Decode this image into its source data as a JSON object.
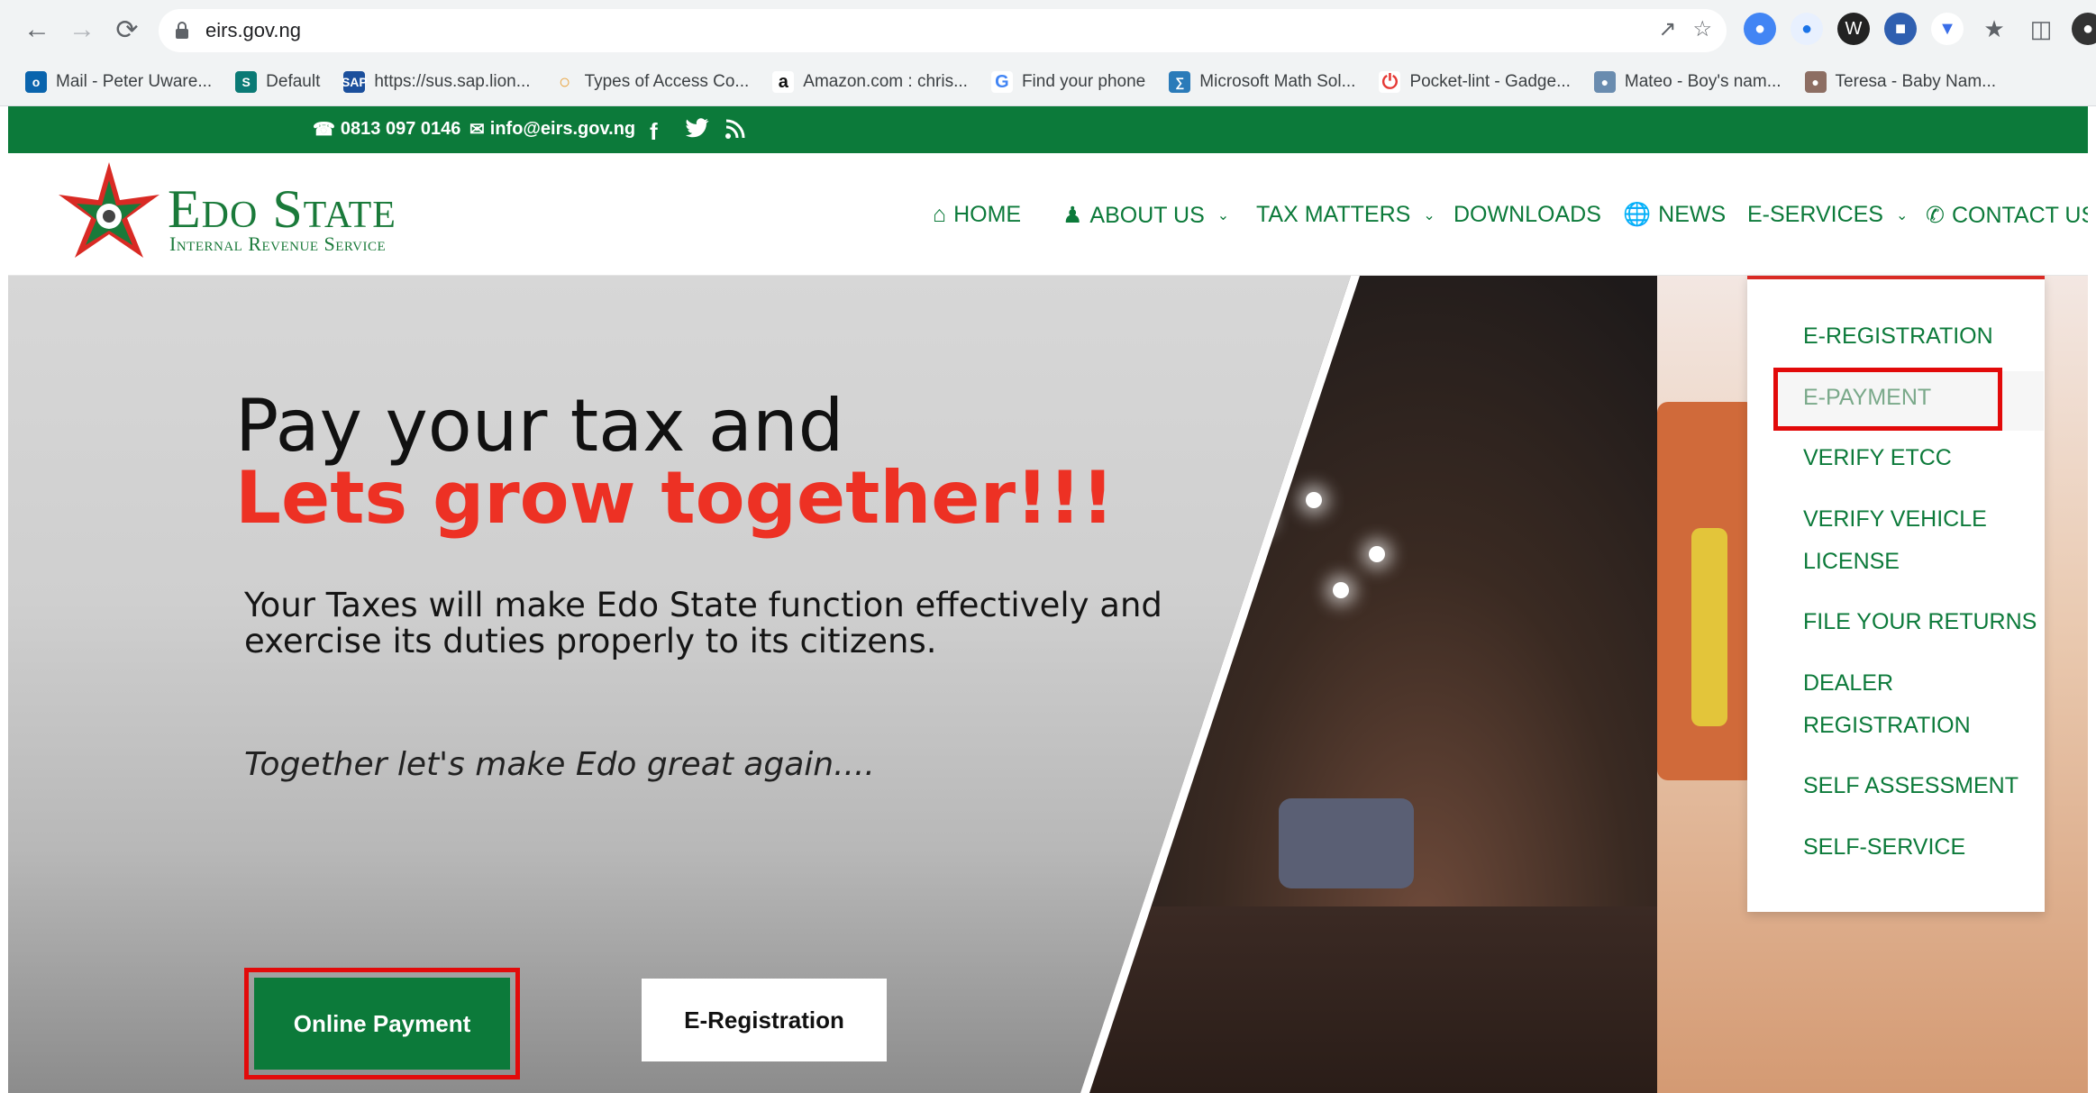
{
  "browser": {
    "url": "eirs.gov.ng",
    "bookmarks": [
      {
        "label": "Mail - Peter Uware...",
        "icon": "outlook-icon",
        "color": "#0a64ad"
      },
      {
        "label": "Default",
        "icon": "sharepoint-icon",
        "color": "#0b7a75"
      },
      {
        "label": "https://sus.sap.lion...",
        "icon": "sap-icon",
        "color": "#1b4f9c"
      },
      {
        "label": "Types of Access Co...",
        "icon": "loading-icon",
        "color": "#e9a23b"
      },
      {
        "label": "Amazon.com : chris...",
        "icon": "amazon-icon",
        "color": "#111111"
      },
      {
        "label": "Find your phone",
        "icon": "google-icon",
        "color": "#4285f4"
      },
      {
        "label": "Microsoft Math Sol...",
        "icon": "math-solver-icon",
        "color": "#2b7bb9"
      },
      {
        "label": "Pocket-lint - Gadge...",
        "icon": "pocket-lint-icon",
        "color": "#e53935"
      },
      {
        "label": "Mateo - Boy's nam...",
        "icon": "babyname-icon",
        "color": "#6a8caf"
      },
      {
        "label": "Teresa - Baby Nam...",
        "icon": "babyname-icon",
        "color": "#8d6e63"
      }
    ]
  },
  "topbar": {
    "phone": "0813 097 0146",
    "email": "info@eirs.gov.ng"
  },
  "logo": {
    "title": "Edo State",
    "subtitle": "Internal Revenue Service"
  },
  "nav": {
    "home": "HOME",
    "about": "ABOUT US",
    "tax": "TAX MATTERS",
    "downloads": "DOWNLOADS",
    "news": "NEWS",
    "eservices": "E-SERVICES",
    "contact": "CONTACT US"
  },
  "hero": {
    "heading_line1": "Pay your tax and",
    "heading_line2": "Lets grow together!!!",
    "lede_line1": "Your Taxes will make Edo State function effectively and",
    "lede_line2": "exercise its duties properly to its citizens.",
    "tagline": "Together let's make Edo great again....",
    "btn_online": "Online Payment",
    "btn_ereg": "E-Registration"
  },
  "dropdown": {
    "items": [
      "E-REGISTRATION",
      "E-PAYMENT",
      "VERIFY ETCC",
      "VERIFY VEHICLE",
      "LICENSE",
      "FILE YOUR RETURNS",
      "DEALER",
      "REGISTRATION",
      "SELF ASSESSMENT",
      "SELF-SERVICE"
    ]
  },
  "colors": {
    "brand_green": "#0c7a3a",
    "brand_red": "#ed3124",
    "highlight_red": "#e20a0a"
  }
}
